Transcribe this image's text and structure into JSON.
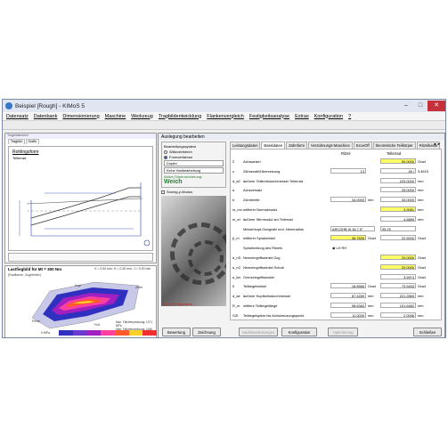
{
  "window": {
    "title": "Beispiel [Rough] - KIMoS 5"
  },
  "menu": [
    "Datensatz",
    "Datenbank",
    "Dimensionierung",
    "Maschine",
    "Werkzeug",
    "Tragbildentwicklung",
    "Flankenvergleich",
    "Festigkeitsanalyse",
    "Extras",
    "Konfiguration",
    "?"
  ],
  "left_top": {
    "header": "Tragbildansicht",
    "tabs": [
      "Tragbild",
      "Grafik"
    ],
    "title": "Rohlingsform",
    "subtitle": "Tellerrad"
  },
  "left_bottom": {
    "title": "Lastfiegbild für Mt = 300 Nm",
    "info": "V = 0.00 mm, H = 0.00 mm, J = 0.00 mm",
    "subtitle": "(Radflanke, Zugbetrieb)",
    "labels": {
      "kopf": "Kopf",
      "zehe": "Zehe",
      "ferse": "Ferse",
      "fuss": "Fuß"
    },
    "legend": [
      "Max. Flächenpressung: 1071 MPa",
      "Max. Flächenpressung: 1166 MPa"
    ],
    "scale_min": "0 MPa"
  },
  "dialog": {
    "title": "Auslegung bearbeiten",
    "process_group": "Bearbeitungssystem",
    "process_options": [
      "Wälzverfahren",
      "Formverfahren"
    ],
    "process_selected": 1,
    "select1": "Duplex",
    "select2": "Keine Hartbearbeitung",
    "active_dim_label": "Aktive Dimensionierung:",
    "active_dim_value": "Weich",
    "sonnig_label": "Sonnig-y-Modus",
    "gear_footer": "DIN ISO Standard",
    "tabs": [
      "Leistungsdaten",
      "Basisdaten",
      "Zahnform",
      "Verzahnungs-Maschine",
      "ExceOff",
      "theoretische Teilkörper",
      "Ritzelkante"
    ],
    "active_tab": 1,
    "col_ritzel": "Ritzel",
    "col_teller": "Tellerrad",
    "rows": [
      {
        "sym": "Σ",
        "label": "Achswinkel",
        "v1": "",
        "u1": "",
        "v2": "90.0000",
        "u2": "Grad",
        "yel2": true
      },
      {
        "sym": "z",
        "label": "Zähnezahl/Übersetzung",
        "v1": "13",
        "u1": "",
        "v2": "45 /",
        "u2": "3.4615"
      },
      {
        "sym": "d_a2",
        "label": "äußerer Teilkreisdurchmesser Tellerrad",
        "v1": "",
        "u1": "",
        "v2": "220.0000",
        "u2": "mm"
      },
      {
        "sym": "a",
        "label": "Achsversatz",
        "v1": "",
        "u1": "",
        "v2": "25.0000",
        "u2": "mm"
      },
      {
        "sym": "b",
        "label": "Zahnbreite",
        "v1": "34.0000",
        "u1": "mm",
        "v2": "30.0000",
        "u2": "mm"
      },
      {
        "sym": "m_mn",
        "label": "mittlerer Normalmodul",
        "v1": "",
        "u1": "",
        "v2": "3.9061",
        "u2": "mm",
        "yel2": true
      },
      {
        "sym": "m_et",
        "label": "äußerer Stirnmodul am Tellerrad",
        "v1": "",
        "u1": "",
        "v2": "4.8889",
        "u2": "mm"
      },
      {
        "sym": "",
        "label": "Messerkopf-Gangzahl und -Nennradius",
        "v1": "ARCOHB III 16-7.5°",
        "u1": "",
        "v2": "95.25",
        "u2": "",
        "sel": true
      },
      {
        "sym": "β_m",
        "label": "mittlerer Spiralwinkel",
        "v1": "36.7835",
        "u1": "Grad",
        "v2": "22.5000",
        "u2": "Grad",
        "yel1": true
      },
      {
        "sym": "",
        "label": "Spiralrichtung des Ritzels",
        "v1": "LH   RH",
        "u1": "",
        "v2": "",
        "u2": "",
        "radio": true
      },
      {
        "sym": "α_nD",
        "label": "Nenneingriffswinkel Zug",
        "v1": "",
        "u1": "",
        "v2": "20.0000",
        "u2": "Grad",
        "yel2": true
      },
      {
        "sym": "α_nC",
        "label": "Nenneingriffswinkel Schub",
        "v1": "",
        "u1": "",
        "v2": "20.0000",
        "u2": "Grad",
        "yel2": true
      },
      {
        "sym": "α_lim",
        "label": "Grenzeingriffswinkel",
        "v1": "",
        "u1": "",
        "v2": "3.5974",
        "u2": "Grad"
      },
      {
        "sym": "δ",
        "label": "Teilkegelwinkel",
        "v1": "18.8966",
        "u1": "Grad",
        "v2": "70.5453",
        "u2": "Grad"
      },
      {
        "sym": "d_ae",
        "label": "äußerer Kopfkreisdurchmesser",
        "v1": "87.4289",
        "u1": "mm",
        "v2": "221.2869",
        "u2": "mm"
      },
      {
        "sym": "R_m",
        "label": "mittlere Teilkegellänge",
        "v1": "98.6360",
        "u1": "mm",
        "v2": "101.6462",
        "u2": "mm"
      },
      {
        "sym": "GZt",
        "label": "Teilkegelspitze bis Achskreuzungspunkt",
        "v1": "11.0039",
        "u1": "mm",
        "v2": "2.0056",
        "u2": "mm"
      }
    ],
    "buttons": [
      "Bewertung",
      "Zeichnung",
      "Nachbearbeitungen",
      "Konfiguration",
      "Optimierung",
      "Schließen"
    ]
  }
}
